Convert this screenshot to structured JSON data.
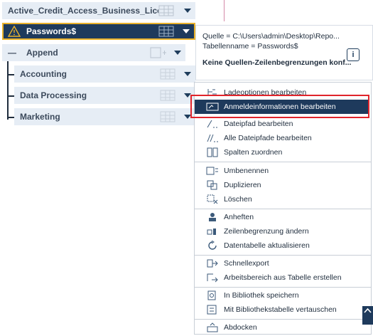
{
  "tree": {
    "root_label": "Active_Credit_Access_Business_Licenses",
    "selected_label": "Passwords$",
    "append_label": "Append",
    "children": [
      {
        "label": "Accounting"
      },
      {
        "label": "Data Processing"
      },
      {
        "label": "Marketing"
      }
    ]
  },
  "info": {
    "source": "Quelle = C:\\Users\\admin\\Desktop\\Repo...",
    "table_name": "Tabellenname = Passwords$",
    "limit": "Keine Quellen-Zeilenbegrenzungen konf...",
    "info_button": "i"
  },
  "menu": {
    "items": [
      {
        "label": "Ladeoptionen bearbeiten",
        "icon": "load-options-icon"
      },
      {
        "label": "Anmeldeinformationen bearbeiten",
        "icon": "credentials-icon"
      },
      {
        "label": "Dateipfad bearbeiten",
        "icon": "file-path-icon"
      },
      {
        "label": "Alle Dateipfade bearbeiten",
        "icon": "all-file-paths-icon"
      },
      {
        "label": "Spalten zuordnen",
        "icon": "map-columns-icon"
      },
      {
        "label": "Umbenennen",
        "icon": "rename-icon"
      },
      {
        "label": "Duplizieren",
        "icon": "duplicate-icon"
      },
      {
        "label": "Löschen",
        "icon": "delete-icon"
      },
      {
        "label": "Anheften",
        "icon": "pin-icon"
      },
      {
        "label": "Zeilenbegrenzung ändern",
        "icon": "row-limit-icon"
      },
      {
        "label": "Datentabelle aktualisieren",
        "icon": "refresh-icon"
      },
      {
        "label": "Schnellexport",
        "icon": "quick-export-icon"
      },
      {
        "label": "Arbeitsbereich aus Tabelle erstellen",
        "icon": "create-workspace-icon"
      },
      {
        "label": "In Bibliothek speichern",
        "icon": "save-library-icon"
      },
      {
        "label": "Mit Bibliothekstabelle vertauschen",
        "icon": "swap-library-icon"
      },
      {
        "label": "Abdocken",
        "icon": "undock-icon"
      }
    ]
  },
  "colors": {
    "accent": "#1e3a5c",
    "node_bg": "#e6edf5",
    "highlight_border": "#e0242b",
    "warning": "#e8b12b"
  }
}
